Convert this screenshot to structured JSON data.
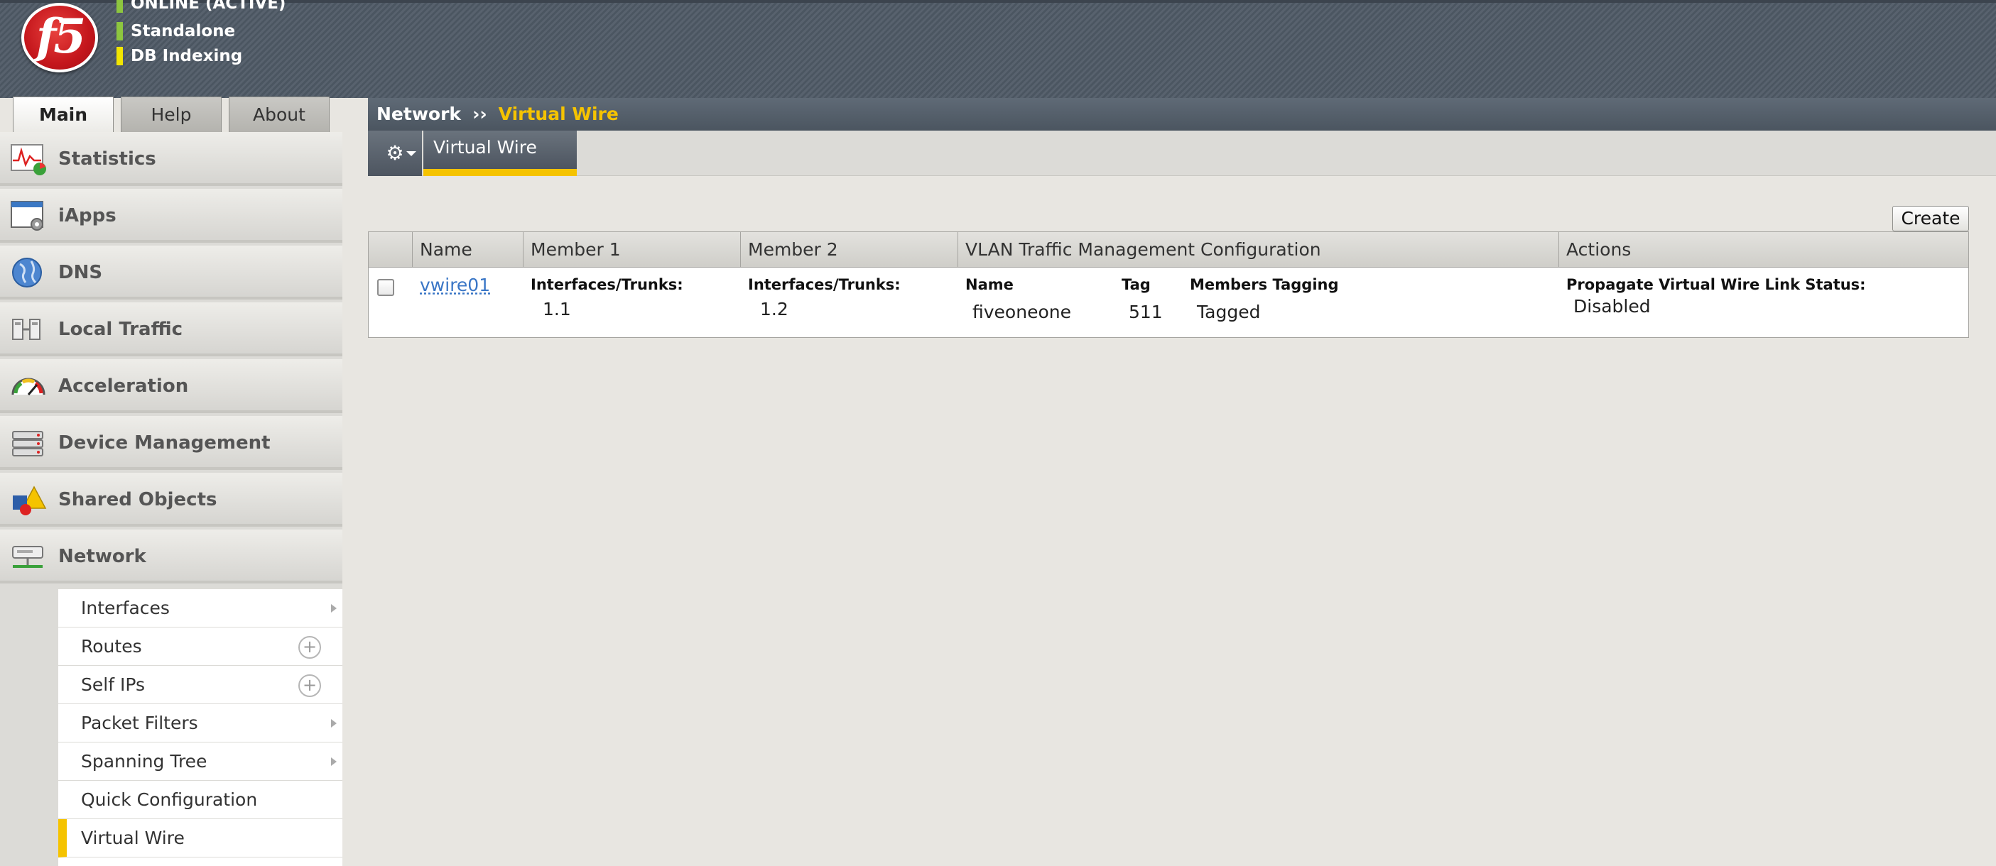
{
  "header": {
    "logo_text": "f5",
    "status": [
      {
        "label": "ONLINE (ACTIVE)",
        "color": "#8dc63f"
      },
      {
        "label": "Standalone",
        "color": "#8dc63f"
      },
      {
        "label": "DB Indexing",
        "color": "#f2e600"
      }
    ]
  },
  "top_tabs": [
    {
      "label": "Main",
      "active": true
    },
    {
      "label": "Help",
      "active": false
    },
    {
      "label": "About",
      "active": false
    }
  ],
  "sidebar": {
    "items": [
      {
        "label": "Statistics",
        "icon": "statistics-icon"
      },
      {
        "label": "iApps",
        "icon": "iapps-icon"
      },
      {
        "label": "DNS",
        "icon": "globe-icon"
      },
      {
        "label": "Local Traffic",
        "icon": "local-traffic-icon"
      },
      {
        "label": "Acceleration",
        "icon": "gauge-icon"
      },
      {
        "label": "Device Management",
        "icon": "device-icon"
      },
      {
        "label": "Shared Objects",
        "icon": "shapes-icon"
      },
      {
        "label": "Network",
        "icon": "network-icon"
      }
    ],
    "network_subitems": [
      {
        "label": "Interfaces",
        "suffix": "arrow"
      },
      {
        "label": "Routes",
        "suffix": "plus"
      },
      {
        "label": "Self IPs",
        "suffix": "plus"
      },
      {
        "label": "Packet Filters",
        "suffix": "arrow"
      },
      {
        "label": "Spanning Tree",
        "suffix": "arrow"
      },
      {
        "label": "Quick Configuration",
        "suffix": "none"
      },
      {
        "label": "Virtual Wire",
        "suffix": "none",
        "active": true
      }
    ]
  },
  "breadcrumb": {
    "root": "Network",
    "separator": "››",
    "current": "Virtual Wire"
  },
  "tabs": {
    "gear_icon": "gear-icon",
    "active_tab": "Virtual Wire"
  },
  "actions": {
    "create_label": "Create"
  },
  "table": {
    "headers": [
      "Name",
      "Member 1",
      "Member 2",
      "VLAN Traffic Management Configuration",
      "Actions"
    ],
    "rows": [
      {
        "name": "vwire01",
        "member1_label": "Interfaces/Trunks:",
        "member1_value": "1.1",
        "member2_label": "Interfaces/Trunks:",
        "member2_value": "1.2",
        "vlan_name_label": "Name",
        "vlan_name": "fiveoneone",
        "vlan_tag_label": "Tag",
        "vlan_tag": "511",
        "vlan_tagging_label": "Members Tagging",
        "vlan_tagging": "Tagged",
        "actions_label": "Propagate Virtual Wire Link Status:",
        "actions_value": "Disabled"
      }
    ]
  }
}
